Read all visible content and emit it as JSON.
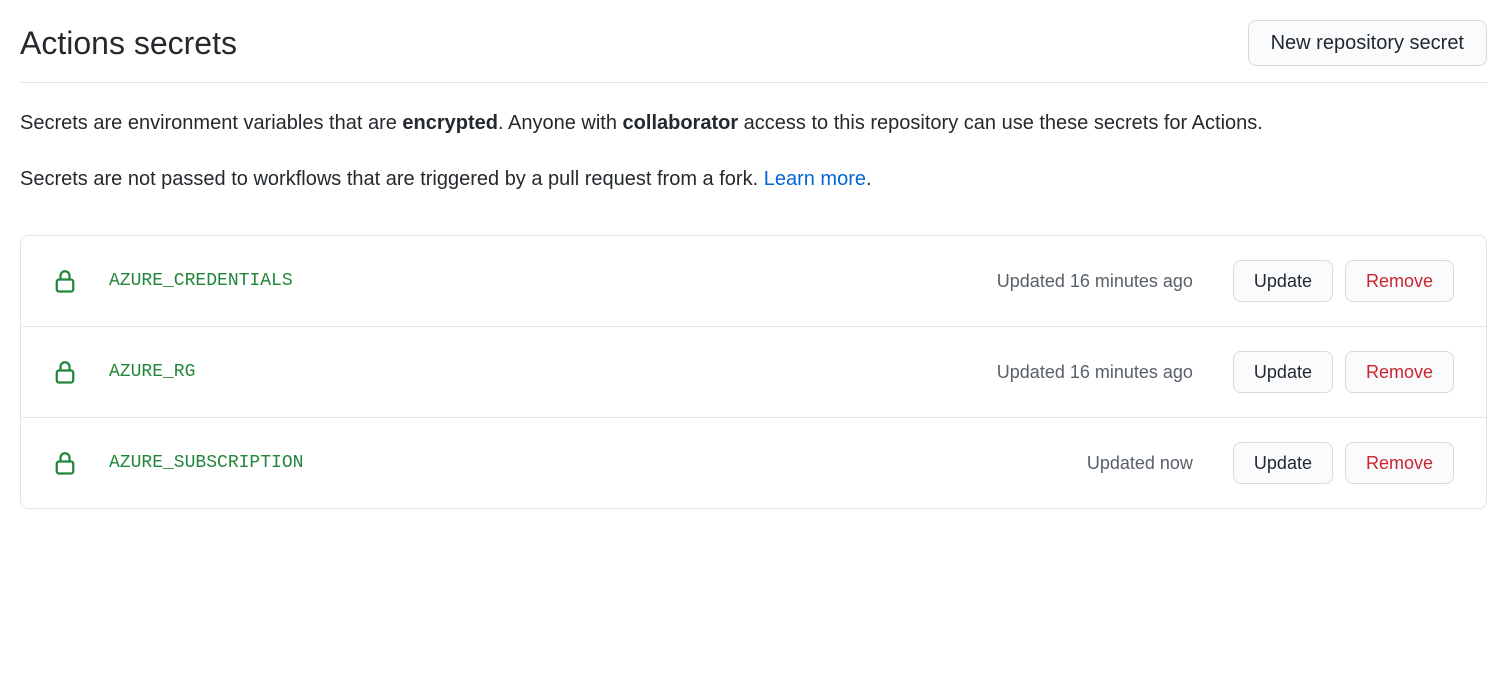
{
  "header": {
    "title": "Actions secrets",
    "new_button_label": "New repository secret"
  },
  "description": {
    "prefix": "Secrets are environment variables that are ",
    "bold1": "encrypted",
    "mid": ". Anyone with ",
    "bold2": "collaborator",
    "suffix": " access to this repository can use these secrets for Actions."
  },
  "note": {
    "text": "Secrets are not passed to workflows that are triggered by a pull request from a fork. ",
    "link_label": "Learn more",
    "period": "."
  },
  "buttons": {
    "update": "Update",
    "remove": "Remove"
  },
  "secrets": [
    {
      "name": "AZURE_CREDENTIALS",
      "updated": "Updated 16 minutes ago"
    },
    {
      "name": "AZURE_RG",
      "updated": "Updated 16 minutes ago"
    },
    {
      "name": "AZURE_SUBSCRIPTION",
      "updated": "Updated now"
    }
  ]
}
